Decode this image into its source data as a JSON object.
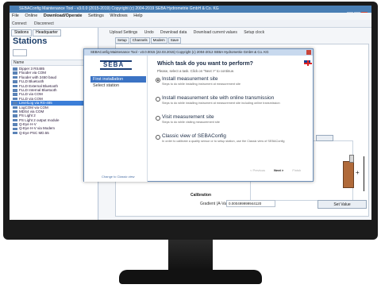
{
  "app": {
    "title": "SEBAConfig Maintenance Tool - v3.0.0 (2015-2019) Copyright (c) 2004-2019 SEBA Hydrometrie GmbH & Co. KG",
    "menu": [
      "File",
      "Online",
      "Download/Operate",
      "Settings",
      "Windows",
      "Help"
    ],
    "connect": [
      "Connect",
      "Disconnect"
    ]
  },
  "left": {
    "tabs": [
      "Stations",
      "Headquarter"
    ],
    "title": "Stations",
    "column_header": "Name",
    "stations": [
      "Dipper 3 RS485",
      "Flooder via COM",
      "Flooder with 2450 baud",
      "FLLD Bluetooth",
      "FLLD External Bluetooth",
      "FLLD Internal Bluetooth",
      "FLLD via COM",
      "FLLD via COM",
      "LevelLog via RS-485",
      "LogCOM via COM",
      "MDS4 via COM",
      "PS Light 2",
      "PS Light 2 output module",
      "Q-Eye H-V",
      "Q-Eye H-V via Modem",
      "Q-Eye PSC MD.55"
    ],
    "selected_index": 8
  },
  "toolbar": [
    "Upload Settings",
    "Undo",
    "Download data",
    "Download current values",
    "Setup clock"
  ],
  "subtabs": [
    "Setup",
    "Channels",
    "Modem",
    "Save"
  ],
  "calibration": {
    "label": "Calibration",
    "gradient_label": "Gradient (A-Value)",
    "gradient_value": "0.000499999944120",
    "set_value": "Set Value"
  },
  "dialog": {
    "title": "SEBAConfig Maintenance Tool - v3.0.0015 (22.03.2015) Copyright (c) 2004-2012 SEBA Hydrometrie GmbH & Co. KG",
    "logo": "SEBA",
    "nav": [
      "First installation",
      "Select station"
    ],
    "question": "Which task do you want to perform?",
    "question_sub": "Please, select a task. Click on \"Next >\" to continue.",
    "options": [
      {
        "title": "Install measurement site",
        "desc": "Steps to do while installing instrument at measurement site",
        "selected": true
      },
      {
        "title": "Install measurement site with online transmission",
        "desc": "Steps to do while installing instrument at measurement site including online transmission",
        "selected": false
      },
      {
        "title": "Visit measurement site",
        "desc": "Steps to do while visiting measurement site",
        "selected": false
      },
      {
        "title": "Classic view of SEBAConfig",
        "desc": "In order to calibrate a quality sensor or to setup station, use the Classic view of SEBAConfig",
        "selected": false
      }
    ],
    "change_link": "Change to Classic view",
    "buttons": [
      "< Previous",
      "Next >",
      "Finish"
    ]
  }
}
